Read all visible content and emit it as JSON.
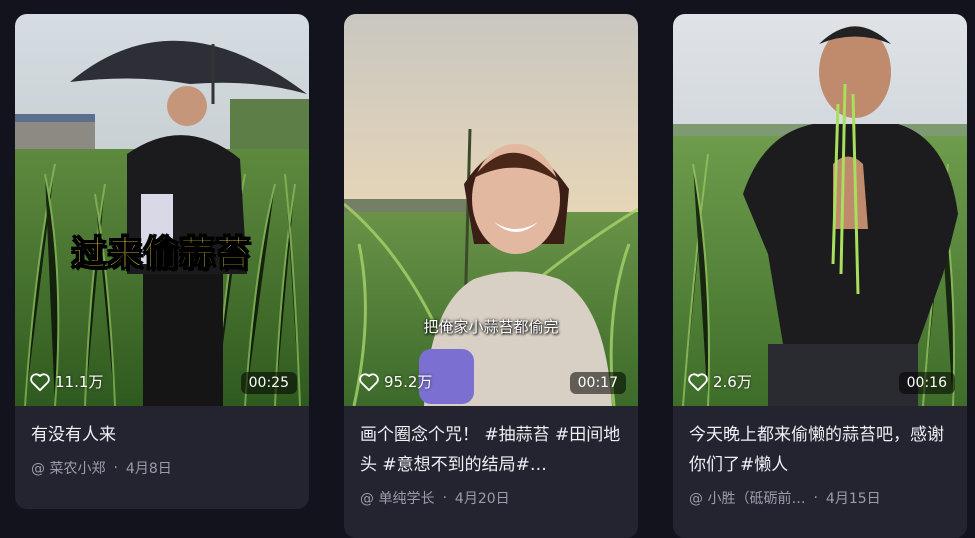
{
  "cards": [
    {
      "overlay_text": "过来偷蒜苔",
      "likes": "11.1万",
      "duration": "00:25",
      "title": "有没有人来",
      "author": "@ 菜农小郑",
      "date": "4月8日"
    },
    {
      "overlay_text": "把俺家小蒜苔都偷完",
      "likes": "95.2万",
      "duration": "00:17",
      "title": "画个圈念个咒！ #抽蒜苔 #田间地头 #意想不到的结局#…",
      "author": "@ 单纯学长",
      "date": "4月20日"
    },
    {
      "likes": "2.6万",
      "duration": "00:16",
      "title": "今天晚上都来偷懒的蒜苔吧，感谢你们了#懒人",
      "author": "@ 小胜（砥砺前…",
      "date": "4月15日"
    }
  ],
  "colors": {
    "background": "#12131c",
    "card": "#23242f",
    "overlay_yellow": "#ffe14a"
  }
}
